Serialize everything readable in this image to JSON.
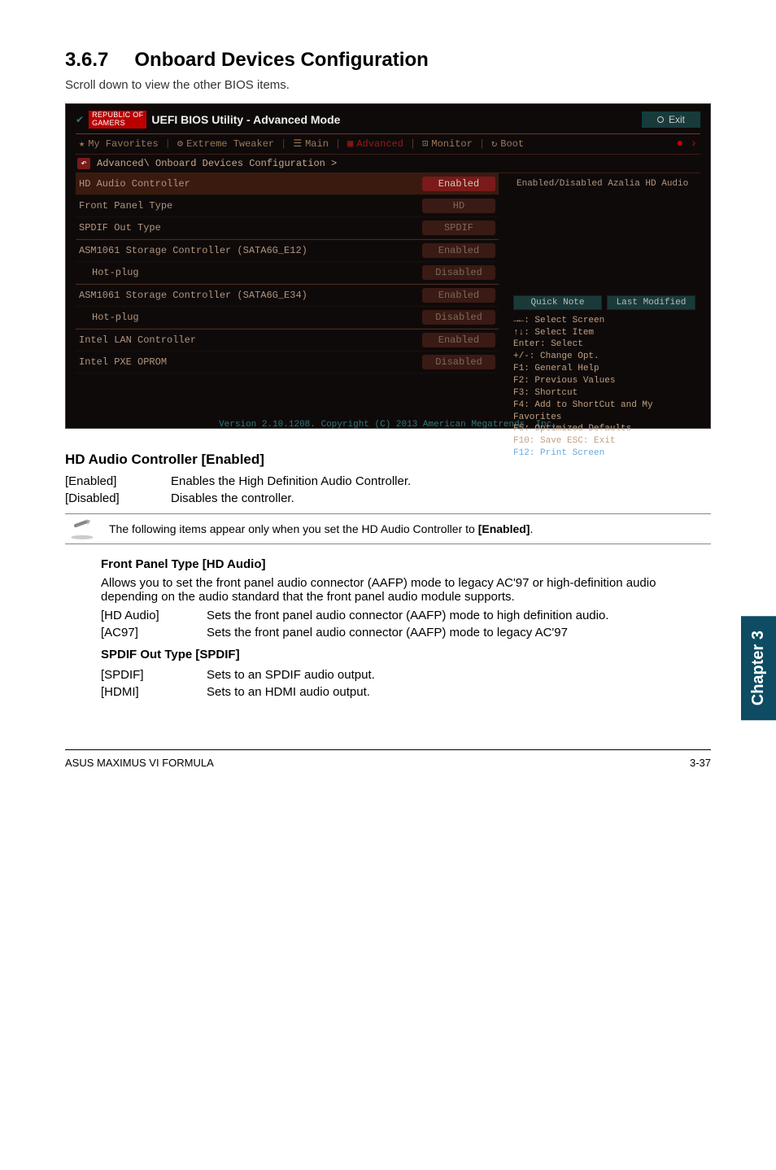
{
  "section": {
    "number": "3.6.7",
    "title": "Onboard Devices Configuration"
  },
  "scroll_note": "Scroll down to view the other BIOS items.",
  "bios": {
    "logo_line1": "REPUBLIC OF",
    "logo_line2": "GAMERS",
    "title": "UEFI BIOS Utility - Advanced Mode",
    "exit": "Exit",
    "menu": {
      "favorites": "My Favorites",
      "tweaker": "Extreme Tweaker",
      "main": "Main",
      "advanced": "Advanced",
      "monitor": "Monitor",
      "boot": "Boot"
    },
    "breadcrumb": "Advanced\\ Onboard Devices Configuration >",
    "rows": {
      "hd_audio": {
        "label": "HD Audio Controller",
        "value": "Enabled"
      },
      "front_panel": {
        "label": "Front Panel Type",
        "value": "HD"
      },
      "spdif": {
        "label": "SPDIF Out Type",
        "value": "SPDIF"
      },
      "asm1": {
        "label": "ASM1061 Storage Controller (SATA6G_E12)",
        "value": "Enabled"
      },
      "hot1": {
        "label": "Hot-plug",
        "value": "Disabled"
      },
      "asm2": {
        "label": "ASM1061 Storage Controller (SATA6G_E34)",
        "value": "Enabled"
      },
      "hot2": {
        "label": "Hot-plug",
        "value": "Disabled"
      },
      "lan": {
        "label": "Intel LAN Controller",
        "value": "Enabled"
      },
      "pxe": {
        "label": "Intel PXE OPROM",
        "value": "Disabled"
      }
    },
    "help_desc": "Enabled/Disabled Azalia HD Audio",
    "quick_note": "Quick Note",
    "last_modified": "Last Modified",
    "keys": {
      "l1": "→←: Select Screen",
      "l2": "↑↓: Select Item",
      "l3": "Enter: Select",
      "l4": "+/-: Change Opt.",
      "l5": "F1: General Help",
      "l6": "F2: Previous Values",
      "l7": "F3: Shortcut",
      "l8": "F4: Add to ShortCut and My Favorites",
      "l9": "F5: Optimized Defaults",
      "l10": "F10: Save  ESC: Exit",
      "l11": "F12: Print Screen"
    },
    "footer": "Version 2.10.1208. Copyright (C) 2013 American Megatrends, Inc."
  },
  "items": {
    "hd_audio": {
      "heading": "HD Audio Controller [Enabled]",
      "opts": [
        {
          "k": "[Enabled]",
          "v": "Enables the High Definition Audio Controller."
        },
        {
          "k": "[Disabled]",
          "v": "Disables the controller."
        }
      ],
      "note": "The following items appear only when you set the HD Audio Controller to [Enabled]."
    },
    "front_panel": {
      "heading": "Front Panel Type [HD Audio]",
      "body": "Allows you to set the front panel audio connector (AAFP) mode to legacy AC'97 or high-definition audio depending on the audio standard that the front panel audio module supports.",
      "opts": [
        {
          "k": "[HD Audio]",
          "v": "Sets the front panel audio connector (AAFP) mode to high definition audio."
        },
        {
          "k": "[AC97]",
          "v": "Sets the front panel audio connector (AAFP) mode to legacy AC'97"
        }
      ]
    },
    "spdif": {
      "heading": "SPDIF Out Type [SPDIF]",
      "opts": [
        {
          "k": "[SPDIF]",
          "v": "Sets to an SPDIF audio output."
        },
        {
          "k": "[HDMI]",
          "v": "Sets to an HDMI audio output."
        }
      ]
    }
  },
  "side_tab": "Chapter 3",
  "footer": {
    "left": "ASUS MAXIMUS VI FORMULA",
    "right": "3-37"
  }
}
